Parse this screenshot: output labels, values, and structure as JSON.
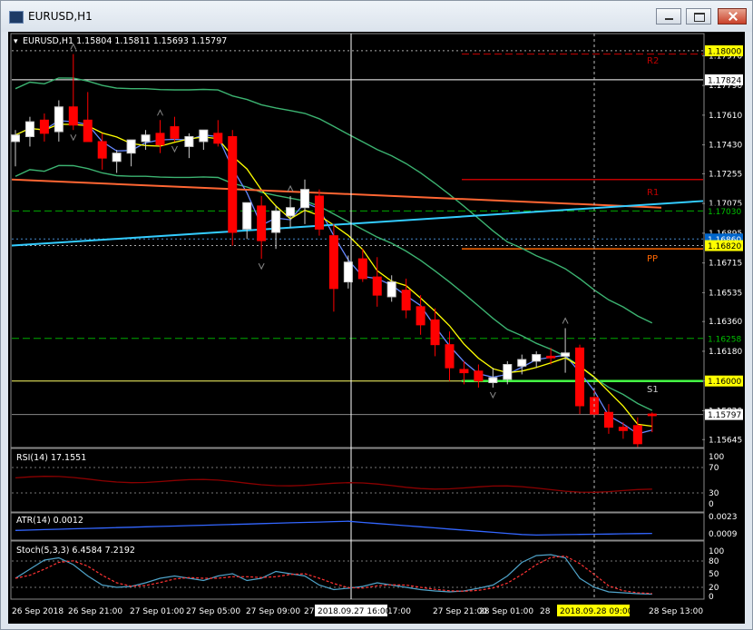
{
  "window": {
    "title": "EURUSD,H1"
  },
  "chart": {
    "header": "EURUSD,H1  1.15804 1.15811 1.15693 1.15797",
    "vline_time_label": "2018.09.27 16:00",
    "vline2_time_label": "2018.09.28 09:00",
    "price_labels": [
      "1.17970",
      "1.17790",
      "1.17610",
      "1.17430",
      "1.17255",
      "1.17075",
      "1.16895",
      "1.16715",
      "1.16535",
      "1.16360",
      "1.16180",
      "1.16000",
      "1.15820",
      "1.15645"
    ],
    "highlight_levels": [
      {
        "label": "1.18000",
        "bg": "#ffff00",
        "fg": "#000000"
      },
      {
        "label": "1.17824",
        "bg": "#ffffff",
        "fg": "#000000"
      },
      {
        "label": "1.17030",
        "bg": "#000000",
        "fg": "#00c000"
      },
      {
        "label": "1.16860",
        "bg": "#0066cc",
        "fg": "#ffffff"
      },
      {
        "label": "1.16820",
        "bg": "#ffff00",
        "fg": "#000000"
      },
      {
        "label": "1.16258",
        "bg": "#000000",
        "fg": "#00c000"
      },
      {
        "label": "1.16000",
        "bg": "#ffff00",
        "fg": "#000000"
      },
      {
        "label": "1.15797",
        "bg": "#ffffff",
        "fg": "#000000"
      }
    ],
    "pivot_labels": {
      "r2": "R2",
      "r1": "R1",
      "pp": "PP",
      "s1": "S1"
    },
    "time_labels": [
      "26 Sep 2018",
      "26 Sep 21:00",
      "27 Sep 01:00",
      "27 Sep 05:00",
      "27 Sep 09:00",
      "27",
      "17:00",
      "27 Sep 21:00",
      "28 Sep 01:00",
      "28",
      "28 Sep 13:00"
    ],
    "rsi": {
      "label": "RSI(14) 17.1551",
      "levels": [
        "100",
        "70",
        "30",
        "0"
      ]
    },
    "atr": {
      "label": "ATR(14) 0.0012",
      "levels": [
        "0.0023",
        "0.0009"
      ]
    },
    "stoch": {
      "label": "Stoch(5,3,3) 6.4584 7.2192",
      "levels": [
        "100",
        "80",
        "50",
        "20",
        "0"
      ]
    },
    "colors": {
      "bull": "#ffffff",
      "bear": "#ff0000",
      "ma_fast": "#ffff00",
      "ma_mid": "#6688ff",
      "bands": "#3cb371",
      "ma_slow": "#ff6633",
      "trend": "#33ccff",
      "rsi": "#8b0000",
      "atr": "#3366ff"
    }
  },
  "chart_data": {
    "type": "candlestick",
    "symbol": "EURUSD",
    "timeframe": "H1",
    "ylim": [
      1.1563,
      1.1806
    ],
    "candles": [
      {
        "o": 1.1745,
        "h": 1.1752,
        "l": 1.173,
        "c": 1.1749
      },
      {
        "o": 1.1748,
        "h": 1.176,
        "l": 1.1742,
        "c": 1.1757
      },
      {
        "o": 1.1758,
        "h": 1.1762,
        "l": 1.1745,
        "c": 1.175
      },
      {
        "o": 1.1751,
        "h": 1.177,
        "l": 1.1745,
        "c": 1.1766
      },
      {
        "o": 1.1766,
        "h": 1.1798,
        "l": 1.1752,
        "c": 1.1755
      },
      {
        "o": 1.1758,
        "h": 1.1775,
        "l": 1.1745,
        "c": 1.1745
      },
      {
        "o": 1.1745,
        "h": 1.175,
        "l": 1.1728,
        "c": 1.1735
      },
      {
        "o": 1.1733,
        "h": 1.174,
        "l": 1.1726,
        "c": 1.1738
      },
      {
        "o": 1.1738,
        "h": 1.1746,
        "l": 1.173,
        "c": 1.1746
      },
      {
        "o": 1.1745,
        "h": 1.1752,
        "l": 1.174,
        "c": 1.1749
      },
      {
        "o": 1.175,
        "h": 1.1758,
        "l": 1.1738,
        "c": 1.1743
      },
      {
        "o": 1.1754,
        "h": 1.176,
        "l": 1.1745,
        "c": 1.1747
      },
      {
        "o": 1.1742,
        "h": 1.175,
        "l": 1.1735,
        "c": 1.1748
      },
      {
        "o": 1.1745,
        "h": 1.1752,
        "l": 1.174,
        "c": 1.1752
      },
      {
        "o": 1.175,
        "h": 1.1758,
        "l": 1.1742,
        "c": 1.1744
      },
      {
        "o": 1.1748,
        "h": 1.1752,
        "l": 1.1682,
        "c": 1.169
      },
      {
        "o": 1.1692,
        "h": 1.1708,
        "l": 1.1686,
        "c": 1.1708
      },
      {
        "o": 1.1706,
        "h": 1.1712,
        "l": 1.1674,
        "c": 1.1685
      },
      {
        "o": 1.169,
        "h": 1.1706,
        "l": 1.168,
        "c": 1.1703
      },
      {
        "o": 1.17,
        "h": 1.1712,
        "l": 1.1693,
        "c": 1.1705
      },
      {
        "o": 1.1705,
        "h": 1.1722,
        "l": 1.1695,
        "c": 1.1716
      },
      {
        "o": 1.1712,
        "h": 1.1716,
        "l": 1.1688,
        "c": 1.1692
      },
      {
        "o": 1.1688,
        "h": 1.1695,
        "l": 1.1642,
        "c": 1.1656
      },
      {
        "o": 1.166,
        "h": 1.1676,
        "l": 1.1656,
        "c": 1.1672
      },
      {
        "o": 1.1674,
        "h": 1.168,
        "l": 1.166,
        "c": 1.1662
      },
      {
        "o": 1.1663,
        "h": 1.1675,
        "l": 1.1645,
        "c": 1.1652
      },
      {
        "o": 1.1651,
        "h": 1.1664,
        "l": 1.1648,
        "c": 1.166
      },
      {
        "o": 1.1655,
        "h": 1.1662,
        "l": 1.1638,
        "c": 1.1643
      },
      {
        "o": 1.1645,
        "h": 1.1652,
        "l": 1.1628,
        "c": 1.1634
      },
      {
        "o": 1.1637,
        "h": 1.1644,
        "l": 1.1615,
        "c": 1.1622
      },
      {
        "o": 1.1622,
        "h": 1.163,
        "l": 1.16,
        "c": 1.1608
      },
      {
        "o": 1.1607,
        "h": 1.1612,
        "l": 1.1598,
        "c": 1.1605
      },
      {
        "o": 1.1606,
        "h": 1.161,
        "l": 1.1596,
        "c": 1.16
      },
      {
        "o": 1.1599,
        "h": 1.1608,
        "l": 1.1596,
        "c": 1.1602
      },
      {
        "o": 1.1601,
        "h": 1.1612,
        "l": 1.1598,
        "c": 1.161
      },
      {
        "o": 1.1609,
        "h": 1.1616,
        "l": 1.1604,
        "c": 1.1613
      },
      {
        "o": 1.1612,
        "h": 1.1618,
        "l": 1.1608,
        "c": 1.1616
      },
      {
        "o": 1.1615,
        "h": 1.162,
        "l": 1.161,
        "c": 1.1614
      },
      {
        "o": 1.1615,
        "h": 1.1632,
        "l": 1.1605,
        "c": 1.1617
      },
      {
        "o": 1.162,
        "h": 1.1622,
        "l": 1.158,
        "c": 1.1585
      },
      {
        "o": 1.159,
        "h": 1.1596,
        "l": 1.1578,
        "c": 1.158
      },
      {
        "o": 1.1581,
        "h": 1.1586,
        "l": 1.1568,
        "c": 1.1572
      },
      {
        "o": 1.1572,
        "h": 1.1575,
        "l": 1.1565,
        "c": 1.157
      },
      {
        "o": 1.1573,
        "h": 1.1578,
        "l": 1.156,
        "c": 1.1562
      },
      {
        "o": 1.158,
        "h": 1.1581,
        "l": 1.1569,
        "c": 1.1579
      }
    ]
  }
}
